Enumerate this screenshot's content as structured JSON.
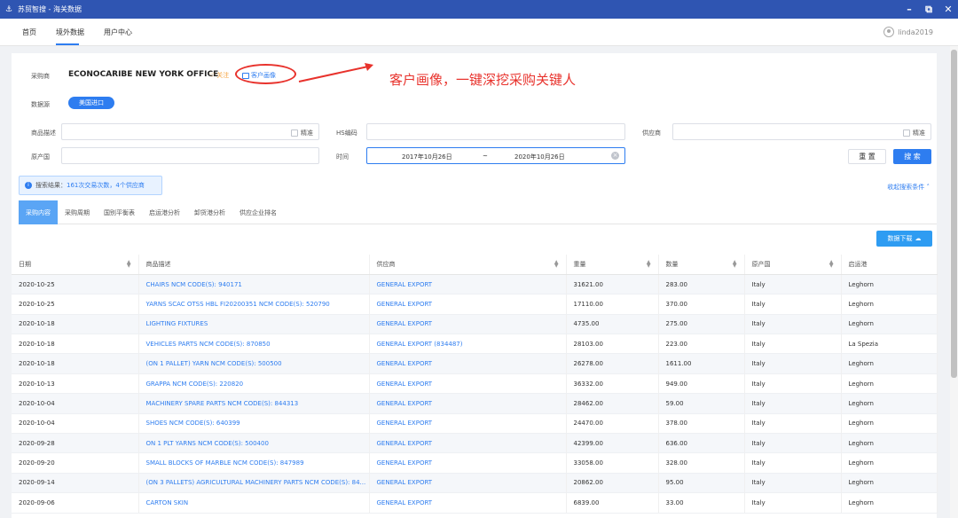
{
  "window": {
    "title": "苏贸智搜 - 海关数据"
  },
  "nav": {
    "items": [
      "首页",
      "境外数据",
      "用户中心"
    ],
    "user": "linda2019"
  },
  "buyer": {
    "label": "采购商",
    "name": "ECONOCARIBE NEW YORK OFFICE",
    "follow": "关注",
    "portrait": "客户画像"
  },
  "annotation": {
    "text": "客户画像，一键深挖采购关键人",
    "color": "#e8322c"
  },
  "source": {
    "label": "数据源",
    "value": "美国进口"
  },
  "filters": {
    "product_label": "商品描述",
    "exact": "精准",
    "hs_label": "HS编码",
    "supplier_label": "供应商",
    "origin_label": "原产国",
    "time_label": "时间",
    "date_from": "2017年10月26日",
    "date_sep": "~",
    "date_to": "2020年10月26日",
    "reset": "重 置",
    "search": "搜 索"
  },
  "result": {
    "prefix": "搜索结果：",
    "count": "161次交易次数，4个供应商",
    "collapse": "收起搜索条件 ˄"
  },
  "tabs": [
    "采购内容",
    "采购周期",
    "国别平衡表",
    "启运港分析",
    "卸货港分析",
    "供应企业排名"
  ],
  "download": "数据下载",
  "table": {
    "headers": [
      "日期",
      "商品描述",
      "供应商",
      "重量",
      "数量",
      "原产国",
      "启运港"
    ],
    "rows": [
      [
        "2020-10-25",
        "CHAIRS NCM CODE(S): 940171",
        "GENERAL EXPORT",
        "31621.00",
        "283.00",
        "Italy",
        "Leghorn"
      ],
      [
        "2020-10-25",
        "YARNS SCAC OTSS HBL FI20200351 NCM CODE(S): 520790",
        "GENERAL EXPORT",
        "17110.00",
        "370.00",
        "Italy",
        "Leghorn"
      ],
      [
        "2020-10-18",
        "LIGHTING FIXTURES",
        "GENERAL EXPORT",
        "4735.00",
        "275.00",
        "Italy",
        "Leghorn"
      ],
      [
        "2020-10-18",
        "VEHICLES PARTS NCM CODE(S): 870850",
        "GENERAL EXPORT (834487)",
        "28103.00",
        "223.00",
        "Italy",
        "La Spezia"
      ],
      [
        "2020-10-18",
        "(ON 1 PALLET) YARN NCM CODE(S): 500500",
        "GENERAL EXPORT",
        "26278.00",
        "1611.00",
        "Italy",
        "Leghorn"
      ],
      [
        "2020-10-13",
        "GRAPPA NCM CODE(S): 220820",
        "GENERAL EXPORT",
        "36332.00",
        "949.00",
        "Italy",
        "Leghorn"
      ],
      [
        "2020-10-04",
        "MACHINERY SPARE PARTS NCM CODE(S): 844313",
        "GENERAL EXPORT",
        "28462.00",
        "59.00",
        "Italy",
        "Leghorn"
      ],
      [
        "2020-10-04",
        "SHOES NCM CODE(S): 640399",
        "GENERAL EXPORT",
        "24470.00",
        "378.00",
        "Italy",
        "Leghorn"
      ],
      [
        "2020-09-28",
        "ON 1 PLT YARNS NCM CODE(S): 500400",
        "GENERAL EXPORT",
        "42399.00",
        "636.00",
        "Italy",
        "Leghorn"
      ],
      [
        "2020-09-20",
        "SMALL BLOCKS OF MARBLE NCM CODE(S): 847989",
        "GENERAL EXPORT",
        "33058.00",
        "328.00",
        "Italy",
        "Leghorn"
      ],
      [
        "2020-09-14",
        "(ON 3 PALLETS) AGRICULTURAL MACHINERY PARTS NCM CODE(S): 84...",
        "GENERAL EXPORT",
        "20862.00",
        "95.00",
        "Italy",
        "Leghorn"
      ],
      [
        "2020-09-06",
        "CARTON SKIN",
        "GENERAL EXPORT",
        "6839.00",
        "33.00",
        "Italy",
        "Leghorn"
      ]
    ]
  }
}
